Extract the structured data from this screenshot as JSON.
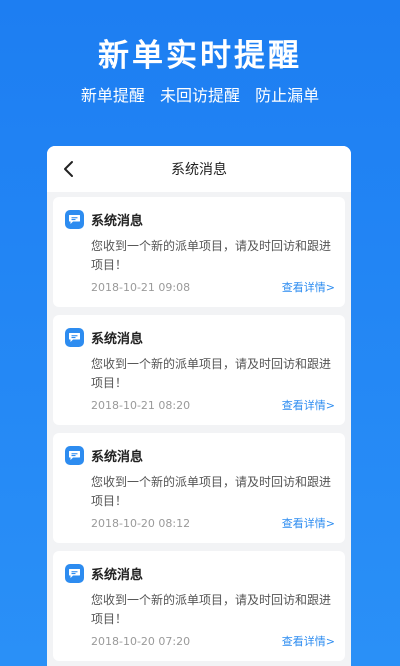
{
  "hero": {
    "title": "新单实时提醒",
    "subtitles": [
      "新单提醒",
      "未回访提醒",
      "防止漏单"
    ]
  },
  "screen": {
    "title": "系统消息",
    "messages": [
      {
        "title": "系统消息",
        "body": "您收到一个新的派单项目，请及时回访和跟进项目！",
        "time": "2018-10-21 09:08",
        "link": "查看详情>"
      },
      {
        "title": "系统消息",
        "body": "您收到一个新的派单项目，请及时回访和跟进项目！",
        "time": "2018-10-21 08:20",
        "link": "查看详情>"
      },
      {
        "title": "系统消息",
        "body": "您收到一个新的派单项目，请及时回访和跟进项目！",
        "time": "2018-10-20 08:12",
        "link": "查看详情>"
      },
      {
        "title": "系统消息",
        "body": "您收到一个新的派单项目，请及时回访和跟进项目！",
        "time": "2018-10-20 07:20",
        "link": "查看详情>"
      }
    ]
  },
  "colors": {
    "background": "#1f88f5",
    "accent": "#2d8cf0"
  },
  "icons": {
    "back": "chevron-left-icon",
    "message": "chat-bubble-icon"
  }
}
